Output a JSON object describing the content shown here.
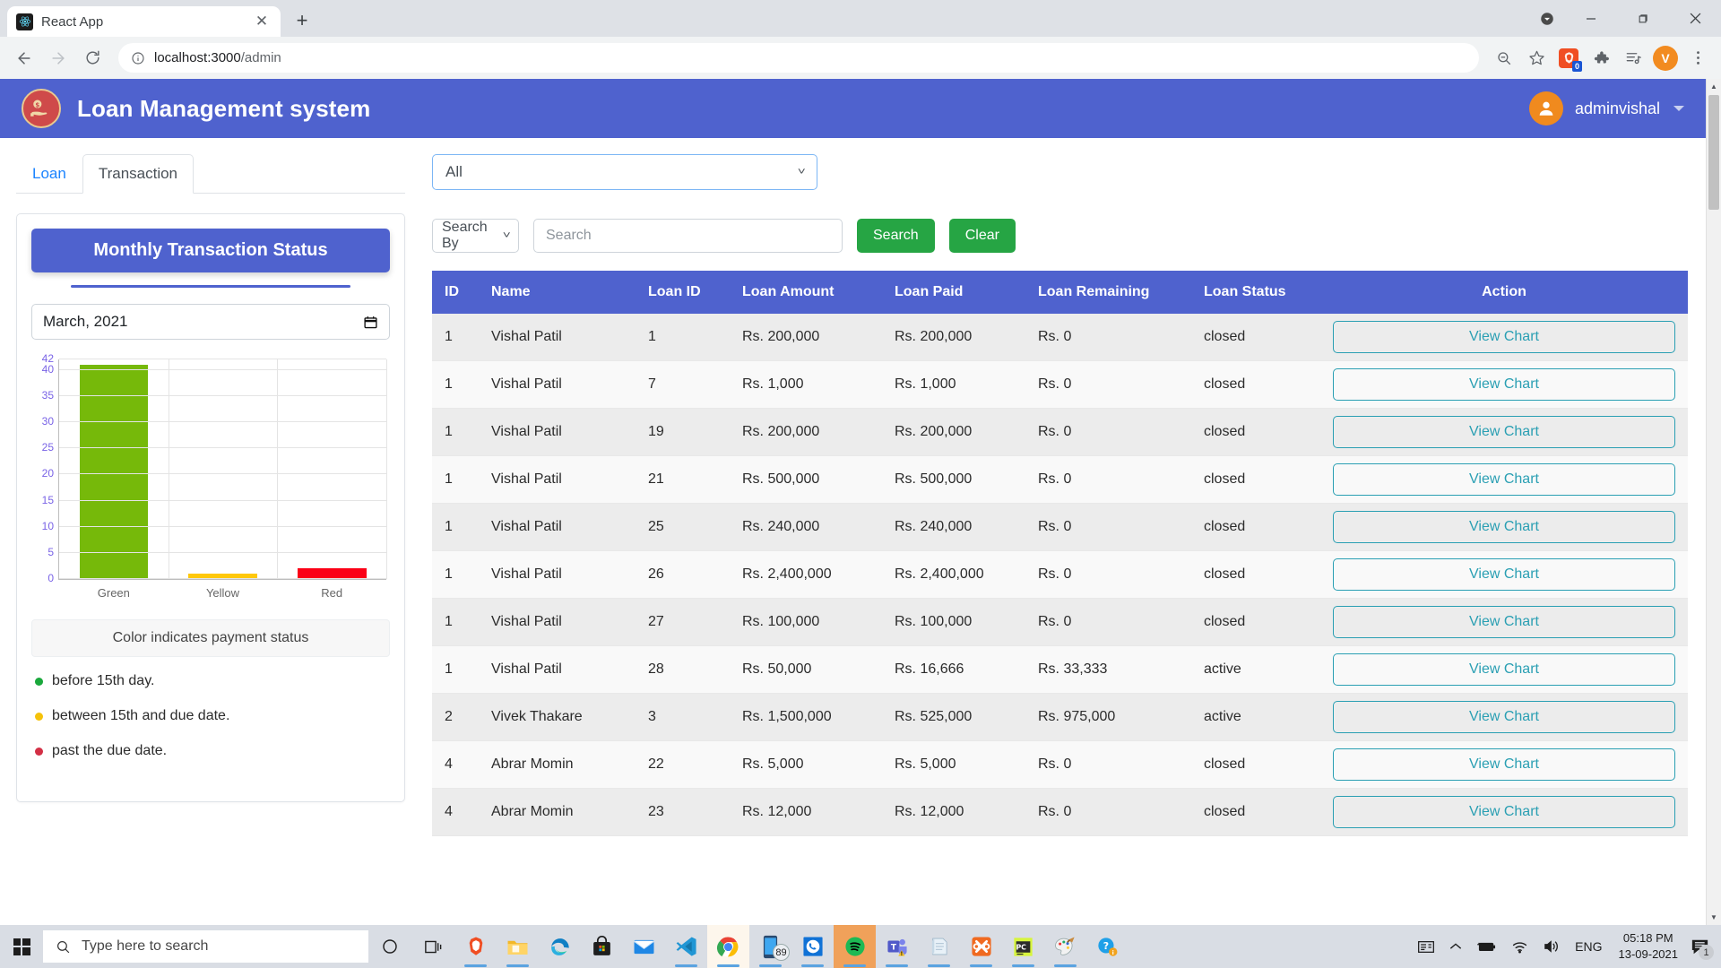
{
  "browser": {
    "tab_title": "React App",
    "favicon": "react-icon",
    "new_tab_label": "+",
    "close_label": "✕",
    "url_host": "localhost:3000",
    "url_path": "/admin",
    "back_icon": "back-arrow-icon",
    "forward_icon": "forward-arrow-icon",
    "reload_icon": "reload-icon",
    "info_icon": "site-info-icon",
    "zoom_out_icon": "zoom-out-icon",
    "bookmark_icon": "star-icon",
    "extension_icon": "brave-extension-icon",
    "extension_badge": "0",
    "puzzle_icon": "extensions-puzzle-icon",
    "reading_list_icon": "reading-list-icon",
    "profile_initial": "V",
    "menu_icon": "three-dot-menu-icon",
    "minimize_label": "—",
    "maximize_label": "❐",
    "close_window_label": "✕"
  },
  "app": {
    "brand_title": "Loan Management system",
    "brand_logo_icon": "loan-hand-coin-icon",
    "user_name": "adminvishal",
    "user_avatar_icon": "person-icon",
    "header_color": "#4f62ce"
  },
  "tabs": [
    {
      "label": "Loan",
      "active": false
    },
    {
      "label": "Transaction",
      "active": true
    }
  ],
  "chart_card": {
    "title": "Monthly Transaction Status",
    "month_value": "March, 2021",
    "calendar_icon": "calendar-icon",
    "legend_header": "Color indicates payment status",
    "legend": [
      {
        "color": "#1aa83c",
        "text": "before 15th day."
      },
      {
        "color": "#f5c20a",
        "text": "between 15th and due date."
      },
      {
        "color": "#d32f45",
        "text": "past the due date."
      }
    ]
  },
  "chart_data": {
    "type": "bar",
    "title": "Monthly Transaction Status",
    "categories": [
      "Green",
      "Yellow",
      "Red"
    ],
    "values": [
      41,
      1,
      2
    ],
    "colors": [
      "#76b90a",
      "#ffc80a",
      "#fb0016"
    ],
    "xlabel": "",
    "ylabel": "",
    "ylim": [
      0,
      42
    ],
    "yticks": [
      0,
      5,
      10,
      15,
      20,
      25,
      30,
      35,
      40,
      42
    ],
    "grid": true,
    "legend_position": "none",
    "tick_color": "#7963e6"
  },
  "filters": {
    "all_select_value": "All",
    "search_by_value": "Search By",
    "search_placeholder": "Search",
    "search_value": "",
    "search_button": "Search",
    "clear_button": "Clear"
  },
  "table": {
    "columns": [
      "ID",
      "Name",
      "Loan ID",
      "Loan Amount",
      "Loan Paid",
      "Loan Remaining",
      "Loan Status",
      "Action"
    ],
    "action_label": "View Chart",
    "rows": [
      {
        "id": "1",
        "name": "Vishal Patil",
        "loan_id": "1",
        "amount": "Rs. 200,000",
        "paid": "Rs. 200,000",
        "remaining": "Rs. 0",
        "status": "closed"
      },
      {
        "id": "1",
        "name": "Vishal Patil",
        "loan_id": "7",
        "amount": "Rs. 1,000",
        "paid": "Rs. 1,000",
        "remaining": "Rs. 0",
        "status": "closed"
      },
      {
        "id": "1",
        "name": "Vishal Patil",
        "loan_id": "19",
        "amount": "Rs. 200,000",
        "paid": "Rs. 200,000",
        "remaining": "Rs. 0",
        "status": "closed"
      },
      {
        "id": "1",
        "name": "Vishal Patil",
        "loan_id": "21",
        "amount": "Rs. 500,000",
        "paid": "Rs. 500,000",
        "remaining": "Rs. 0",
        "status": "closed"
      },
      {
        "id": "1",
        "name": "Vishal Patil",
        "loan_id": "25",
        "amount": "Rs. 240,000",
        "paid": "Rs. 240,000",
        "remaining": "Rs. 0",
        "status": "closed"
      },
      {
        "id": "1",
        "name": "Vishal Patil",
        "loan_id": "26",
        "amount": "Rs. 2,400,000",
        "paid": "Rs. 2,400,000",
        "remaining": "Rs. 0",
        "status": "closed"
      },
      {
        "id": "1",
        "name": "Vishal Patil",
        "loan_id": "27",
        "amount": "Rs. 100,000",
        "paid": "Rs. 100,000",
        "remaining": "Rs. 0",
        "status": "closed"
      },
      {
        "id": "1",
        "name": "Vishal Patil",
        "loan_id": "28",
        "amount": "Rs. 50,000",
        "paid": "Rs. 16,666",
        "remaining": "Rs. 33,333",
        "status": "active"
      },
      {
        "id": "2",
        "name": "Vivek Thakare",
        "loan_id": "3",
        "amount": "Rs. 1,500,000",
        "paid": "Rs. 525,000",
        "remaining": "Rs. 975,000",
        "status": "active"
      },
      {
        "id": "4",
        "name": "Abrar Momin",
        "loan_id": "22",
        "amount": "Rs. 5,000",
        "paid": "Rs. 5,000",
        "remaining": "Rs. 0",
        "status": "closed"
      },
      {
        "id": "4",
        "name": "Abrar Momin",
        "loan_id": "23",
        "amount": "Rs. 12,000",
        "paid": "Rs. 12,000",
        "remaining": "Rs. 0",
        "status": "closed"
      }
    ]
  },
  "taskbar": {
    "start_icon": "windows-start-icon",
    "search_placeholder": "Type here to search",
    "search_icon": "search-icon",
    "cortana_icon": "cortana-circle-icon",
    "task_view_icon": "task-view-icon",
    "apps": [
      {
        "name": "brave-icon",
        "open": true,
        "state": ""
      },
      {
        "name": "file-explorer-icon",
        "open": true,
        "state": ""
      },
      {
        "name": "edge-icon",
        "open": false,
        "state": ""
      },
      {
        "name": "microsoft-store-icon",
        "open": false,
        "state": ""
      },
      {
        "name": "mail-icon",
        "open": false,
        "state": ""
      },
      {
        "name": "vscode-icon",
        "open": true,
        "state": ""
      },
      {
        "name": "chrome-icon",
        "open": true,
        "state": "active"
      },
      {
        "name": "your-phone-icon",
        "open": true,
        "state": "",
        "badge": "89"
      },
      {
        "name": "whatsapp-icon",
        "open": true,
        "state": ""
      },
      {
        "name": "spotify-icon",
        "open": true,
        "state": "hl"
      },
      {
        "name": "microsoft-teams-icon",
        "open": true,
        "state": ""
      },
      {
        "name": "notepad-icon",
        "open": true,
        "state": ""
      },
      {
        "name": "xampp-icon",
        "open": true,
        "state": ""
      },
      {
        "name": "pycharm-icon",
        "open": true,
        "state": ""
      },
      {
        "name": "paint-icon",
        "open": true,
        "state": ""
      },
      {
        "name": "help-icon",
        "open": false,
        "state": ""
      }
    ],
    "tray": {
      "news_icon": "news-and-interests-icon",
      "overflow_icon": "show-hidden-icons-icon",
      "battery_icon": "battery-charging-icon",
      "network_icon": "wifi-icon",
      "volume_icon": "volume-icon",
      "language": "ENG",
      "time": "05:18 PM",
      "date": "13-09-2021",
      "notification_icon": "action-center-icon",
      "notification_count": "1"
    }
  }
}
